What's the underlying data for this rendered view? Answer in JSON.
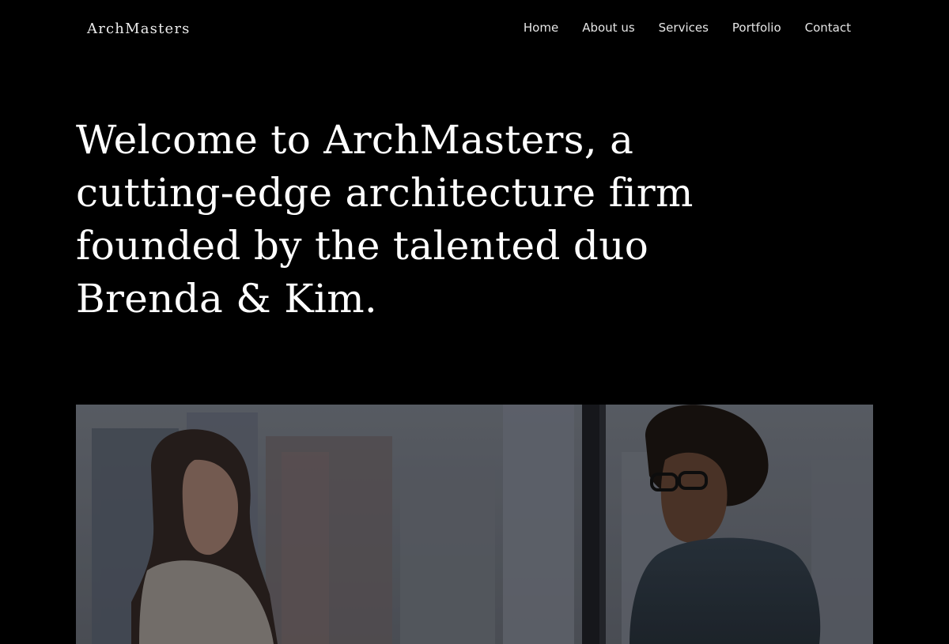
{
  "brand": {
    "name": "ArchMasters"
  },
  "nav": {
    "items": [
      {
        "label": "Home"
      },
      {
        "label": "About us"
      },
      {
        "label": "Services"
      },
      {
        "label": "Portfolio"
      },
      {
        "label": "Contact"
      }
    ]
  },
  "hero": {
    "title": "Welcome to ArchMasters, a cutting-edge architecture firm founded by the talented duo Brenda & Kim."
  },
  "colors": {
    "background": "#000000",
    "text": "#ffffff",
    "nav_text": "#e6e6e6"
  }
}
